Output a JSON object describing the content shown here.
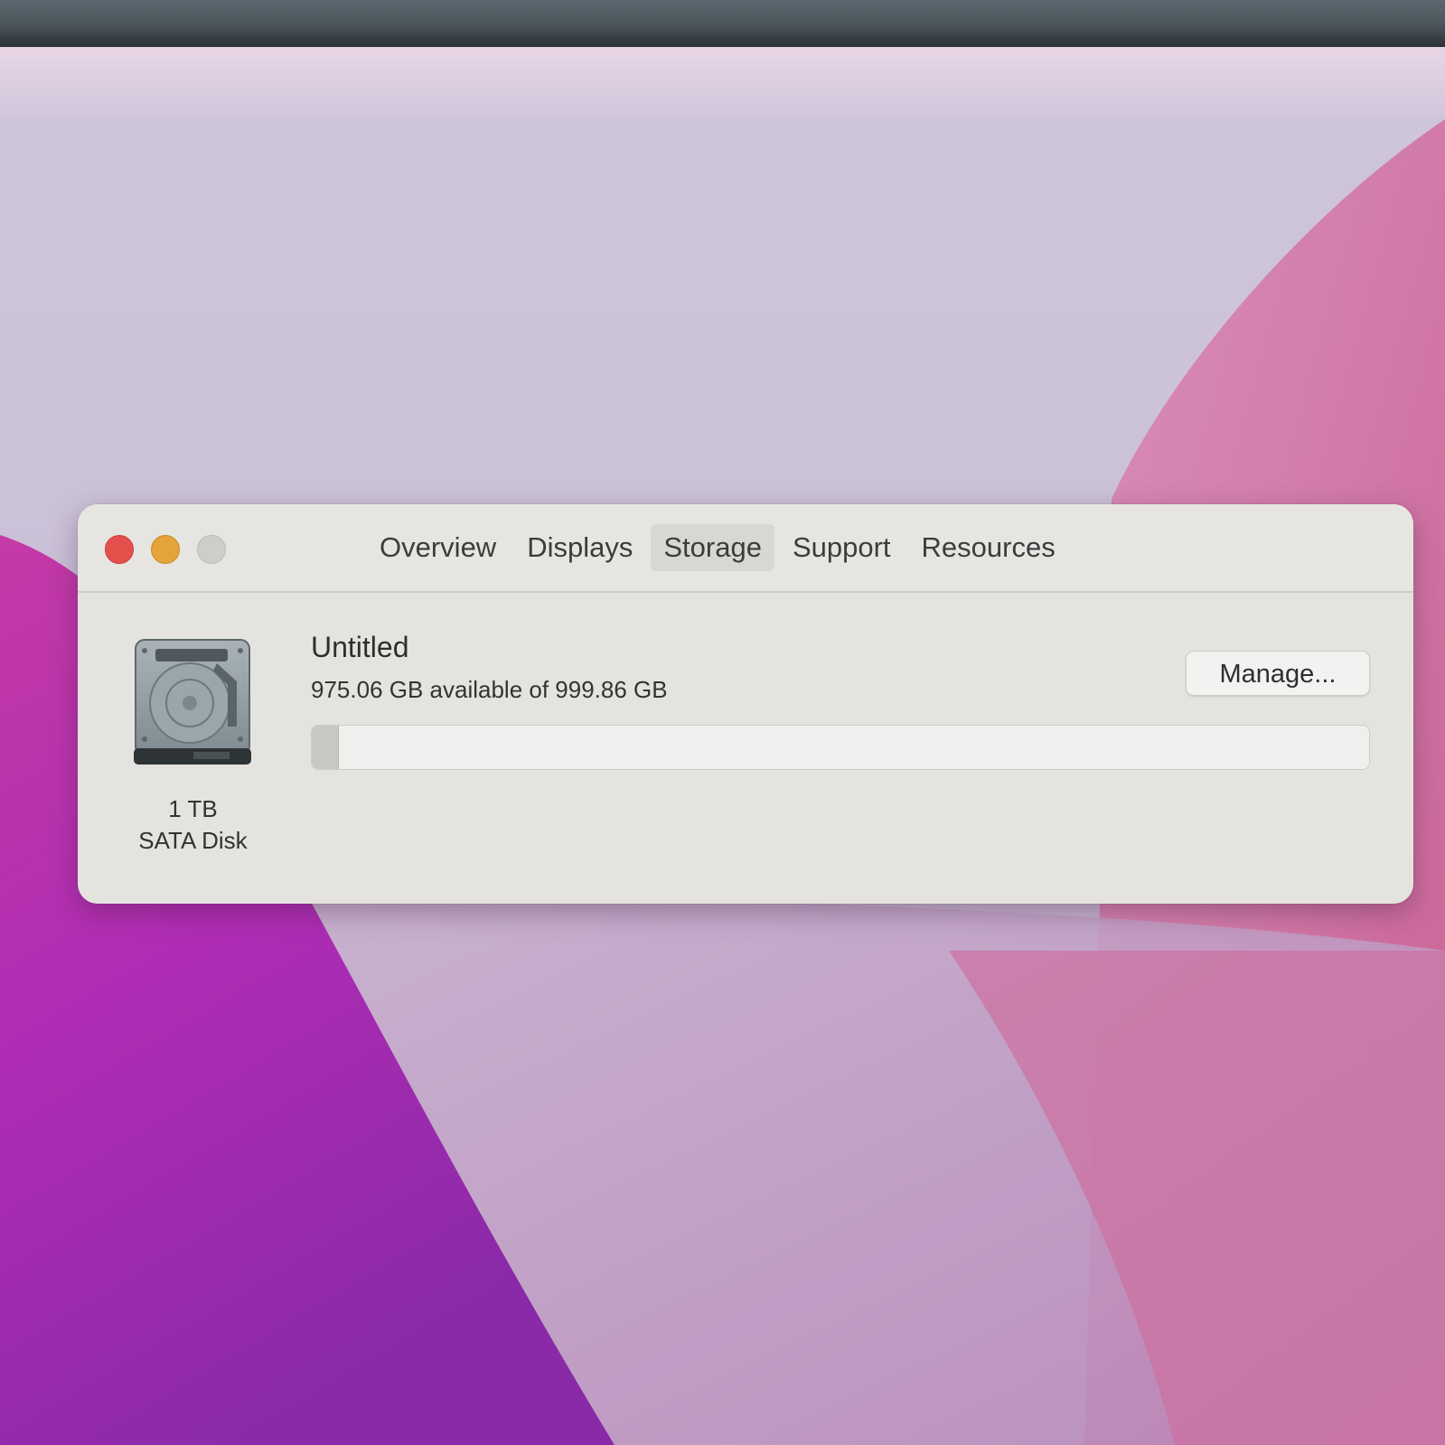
{
  "window": {
    "tabs": [
      {
        "label": "Overview"
      },
      {
        "label": "Displays"
      },
      {
        "label": "Storage",
        "active": true
      },
      {
        "label": "Support"
      },
      {
        "label": "Resources"
      }
    ]
  },
  "disk": {
    "icon": "hard-drive-icon",
    "capacity": "1 TB",
    "type": "SATA Disk"
  },
  "volume": {
    "name": "Untitled",
    "availability": "975.06 GB available of 999.86 GB",
    "used_fraction": 0.025
  },
  "manage_button": {
    "label": "Manage..."
  },
  "colors": {
    "close": "#e6504c",
    "minimize": "#e5a43a",
    "zoom_disabled": "#cfcdca",
    "window_bg": "#e4e3e0"
  }
}
